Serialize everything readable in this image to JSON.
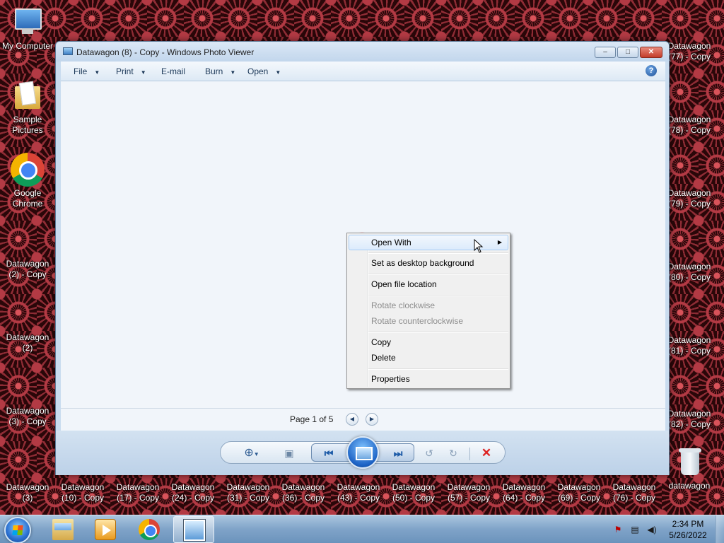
{
  "desktop": {
    "icons": [
      {
        "label": "My Computer"
      },
      {
        "label": "Sample Pictures"
      },
      {
        "label": "Google Chrome"
      },
      {
        "label": "Datawagon (2) - Copy"
      },
      {
        "label": "Datawagon (2)"
      },
      {
        "label": "Datawagon (3) - Copy"
      },
      {
        "label": "Datawagon (3)"
      },
      {
        "label": "Datawagon (10) - Copy"
      },
      {
        "label": "Datawagon (17) - Copy"
      },
      {
        "label": "Datawagon (24) - Copy"
      },
      {
        "label": "Datawagon (31) - Copy"
      },
      {
        "label": "Datawagon (36) - Copy"
      },
      {
        "label": "Datawagon (43) - Copy"
      },
      {
        "label": "Datawagon (50) - Copy"
      },
      {
        "label": "Datawagon (57) - Copy"
      },
      {
        "label": "Datawagon (64) - Copy"
      },
      {
        "label": "Datawagon (69) - Copy"
      },
      {
        "label": "Datawagon (76) - Copy"
      },
      {
        "label": "datawagon"
      },
      {
        "label": "Datawagon (77) - Copy"
      },
      {
        "label": "Datawagon (78) - Copy"
      },
      {
        "label": "Datawagon (79) - Copy"
      },
      {
        "label": "Datawagon (80) - Copy"
      },
      {
        "label": "Datawagon (81) - Copy"
      },
      {
        "label": "Datawagon (82) - Copy"
      }
    ]
  },
  "window": {
    "title": "Datawagon (8) - Copy - Windows Photo Viewer",
    "menu": [
      {
        "label": "File",
        "has_dropdown": true
      },
      {
        "label": "Print",
        "has_dropdown": true
      },
      {
        "label": "E-mail",
        "has_dropdown": false
      },
      {
        "label": "Burn",
        "has_dropdown": true
      },
      {
        "label": "Open",
        "has_dropdown": true
      }
    ],
    "page_text": "Page 1 of 5"
  },
  "context_menu": {
    "items": [
      {
        "label": "Open With",
        "enabled": true,
        "submenu": true,
        "hover": true
      },
      {
        "label": "Set as desktop background",
        "enabled": true
      },
      {
        "label": "Open file location",
        "enabled": true
      },
      {
        "label": "Rotate clockwise",
        "enabled": false
      },
      {
        "label": "Rotate counterclockwise",
        "enabled": false
      },
      {
        "label": "Copy",
        "enabled": true
      },
      {
        "label": "Delete",
        "enabled": true
      },
      {
        "label": "Properties",
        "enabled": true
      }
    ]
  },
  "taskbar": {
    "buttons": [
      {
        "icon": "windows-explorer-icon"
      },
      {
        "icon": "media-player-icon"
      },
      {
        "icon": "chrome-icon"
      },
      {
        "icon": "photo-viewer-icon",
        "active": true
      }
    ],
    "clock_time": "2:34 PM",
    "clock_date": "5/26/2022"
  },
  "colors": {
    "accent": "#1f5ca8",
    "delete": "#dd2222",
    "wallpaper_red": "#b33a44"
  }
}
